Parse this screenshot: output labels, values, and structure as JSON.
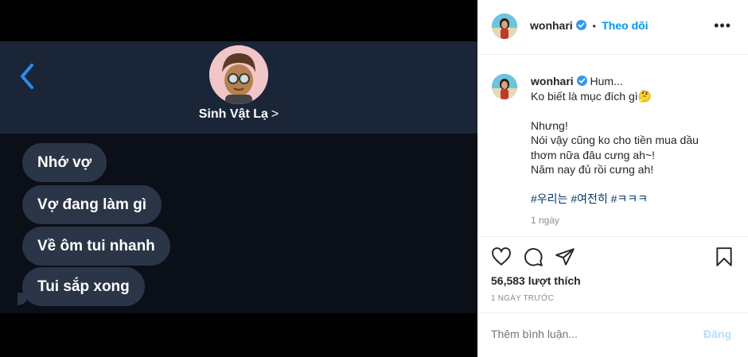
{
  "chat": {
    "contact_name": "Sinh Vật Lạ",
    "contact_chevron": ">",
    "messages": [
      "Nhớ vợ",
      "Vợ đang làm gì",
      "Về ôm tui nhanh",
      "Tui sắp xong"
    ]
  },
  "post": {
    "username": "wonhari",
    "separator": "•",
    "follow_label": "Theo dõi",
    "more_label": "•••",
    "caption": {
      "username": "wonhari",
      "first_line": "Hum...",
      "lines": [
        "Ko biết là mục đích gì🤔",
        "",
        "Nhưng!",
        "Nói vậy cũng ko cho tiền mua dầu",
        "thơm nữa đâu cưng ah~!",
        "Năm nay đủ rồi cưng ah!",
        ""
      ],
      "hashtags": "#우리는 #여전히 #ㅋㅋㅋ",
      "time": "1 ngày"
    },
    "likes": "56,583 lượt thích",
    "date": "1 NGÀY TRƯỚC",
    "comment_placeholder": "Thêm bình luận...",
    "post_label": "Đăng"
  },
  "colors": {
    "chat_header_bg": "#1a2638",
    "bubble_bg": "#2a3547",
    "back_arrow": "#2d8cf0",
    "follow": "#0095f6",
    "post_button_disabled": "#b2dffc"
  },
  "icons": [
    "back-chevron-icon",
    "memoji-avatar",
    "verified-badge-icon",
    "more-options-icon",
    "heart-icon",
    "comment-icon",
    "share-icon",
    "bookmark-icon"
  ]
}
